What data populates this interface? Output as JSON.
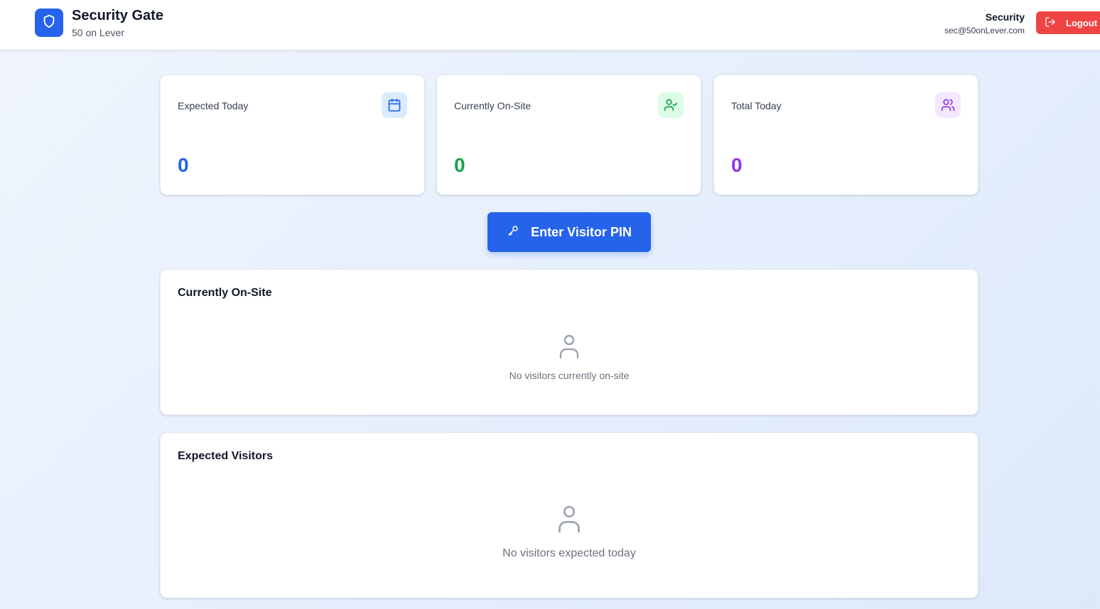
{
  "header": {
    "brand_title": "Security Gate",
    "brand_subtitle": "50 on Lever",
    "brand_icon": "shield-icon",
    "user_role": "Security",
    "user_email": "sec@50onLever.com",
    "logout_label": "Logout",
    "logout_icon": "logout-icon"
  },
  "stats": [
    {
      "label": "Expected Today",
      "value": "0",
      "icon": "calendar-icon",
      "color": "#2563eb",
      "icon_bg": "#dbeafe"
    },
    {
      "label": "Currently On-Site",
      "value": "0",
      "icon": "user-check-icon",
      "color": "#16a34a",
      "icon_bg": "#dcfce7"
    },
    {
      "label": "Total Today",
      "value": "0",
      "icon": "users-icon",
      "color": "#9333ea",
      "icon_bg": "#f3e8ff"
    }
  ],
  "actions": {
    "enter_pin_label": "Enter Visitor PIN",
    "enter_pin_icon": "key-icon"
  },
  "onsite_panel": {
    "title": "Currently On-Site",
    "empty_text": "No visitors currently on-site",
    "empty_icon": "user-icon"
  },
  "expected_panel": {
    "title": "Expected Visitors",
    "empty_text": "No visitors expected today",
    "empty_icon": "user-icon"
  },
  "colors": {
    "primary": "#2563eb",
    "danger": "#ef4444",
    "muted": "#9ca3af"
  }
}
